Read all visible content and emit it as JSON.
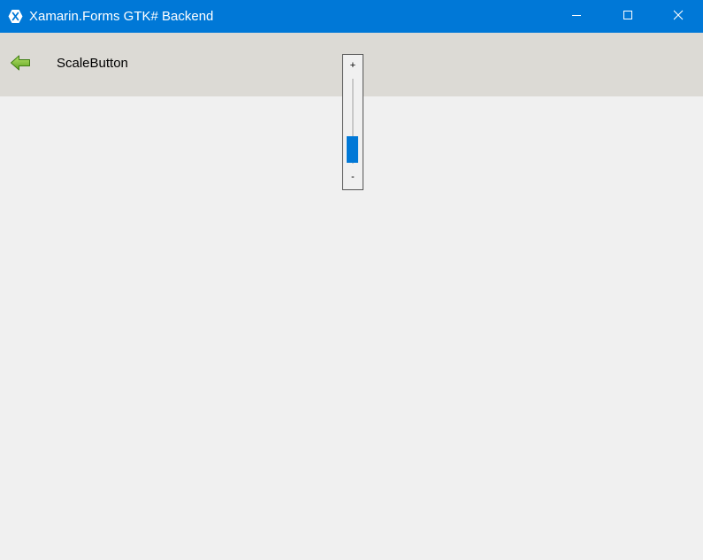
{
  "window": {
    "title": "Xamarin.Forms GTK# Backend",
    "icon": "xamarin-logo-icon",
    "accent_color": "#0078d7",
    "controls": {
      "minimize_icon": "minimize-icon",
      "maximize_icon": "maximize-icon",
      "close_icon": "close-icon"
    }
  },
  "toolbar": {
    "back_icon": "back-arrow-icon",
    "back_icon_color": "#6fb32a",
    "page_title": "ScaleButton",
    "background": "#dcdad5"
  },
  "scale_button": {
    "plus_label": "+",
    "minus_label": "-",
    "value_fraction": 0.2,
    "thumb_color": "#0078d7"
  }
}
